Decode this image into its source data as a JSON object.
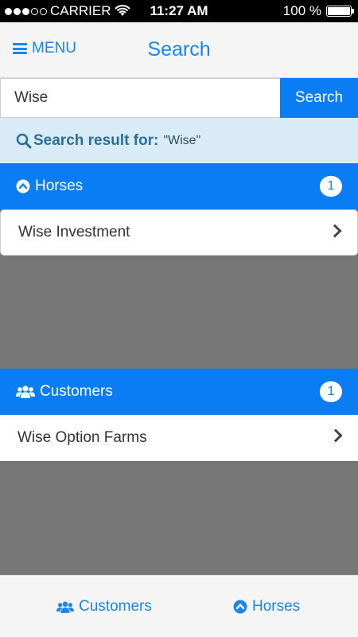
{
  "status_bar": {
    "carrier": "CARRIER",
    "time": "11:27 AM",
    "battery": "100 %",
    "battery_level": 1.0,
    "signal_icon": "signal-dots-icon",
    "wifi_icon": "wifi-icon"
  },
  "nav": {
    "menu_label": "MENU",
    "title": "Search"
  },
  "search": {
    "value": "Wise",
    "button_label": "Search"
  },
  "result_banner": {
    "label": "Search result for:",
    "query": "\"Wise\""
  },
  "sections": [
    {
      "title": "Horses",
      "count": "1",
      "icon": "chevron-circle-up-icon",
      "items": [
        "Wise Investment"
      ]
    },
    {
      "title": "Customers",
      "count": "1",
      "icon": "users-icon",
      "items": [
        "Wise Option Farms"
      ]
    }
  ],
  "tabs": [
    {
      "label": "Customers",
      "icon": "users-icon"
    },
    {
      "label": "Horses",
      "icon": "chevron-circle-up-icon"
    }
  ],
  "colors": {
    "accent": "#0a7df5",
    "banner": "#d8ebf6",
    "background": "#777777"
  }
}
